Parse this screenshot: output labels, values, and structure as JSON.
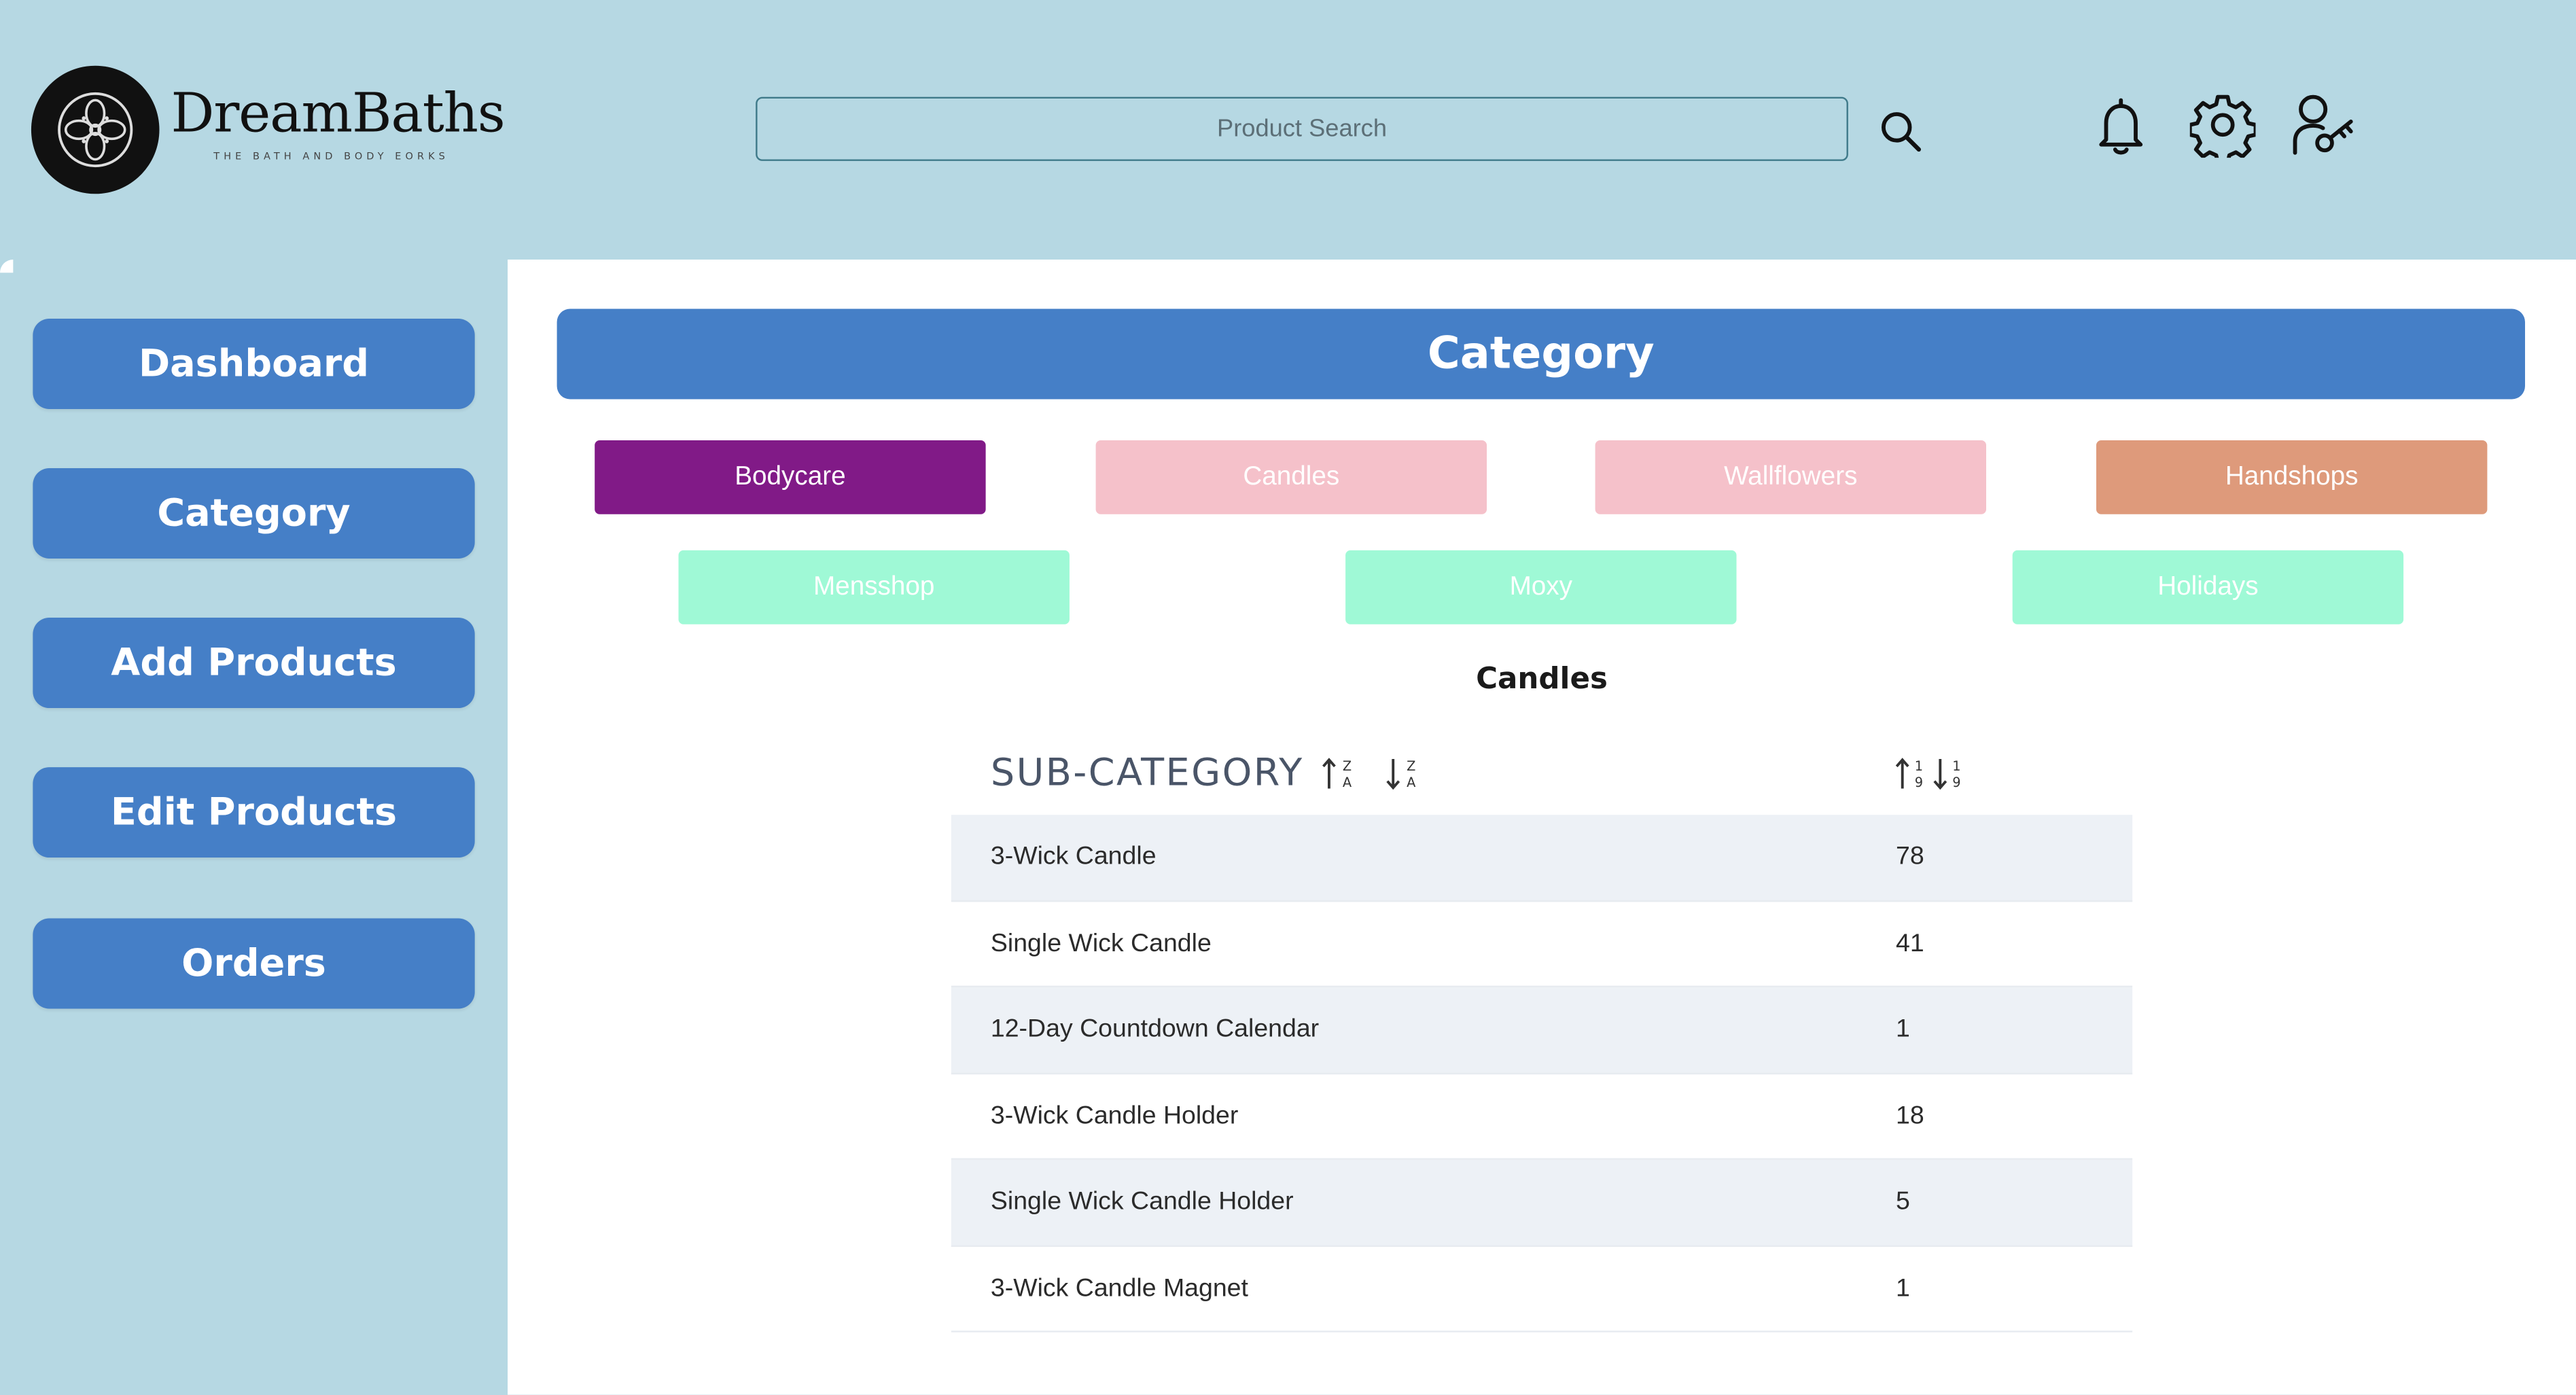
{
  "brand": {
    "name": "DreamBaths",
    "tagline": "THE BATH AND BODY EORKS"
  },
  "header": {
    "search_placeholder": "Product Search",
    "icons": [
      "search-icon",
      "bell-icon",
      "gear-icon",
      "user-key-icon"
    ]
  },
  "sidebar": {
    "items": [
      {
        "label": "Dashboard"
      },
      {
        "label": "Category"
      },
      {
        "label": "Add Products"
      },
      {
        "label": "Edit Products"
      },
      {
        "label": "Orders"
      }
    ]
  },
  "main": {
    "title": "Category",
    "categories": [
      {
        "label": "Bodycare",
        "color": "#811a87",
        "text_color": "#ffffff"
      },
      {
        "label": "Candles",
        "color": "#f5c1ca",
        "text_color": "#ffffff"
      },
      {
        "label": "Wallflowers",
        "color": "#f5c1ca",
        "text_color": "#ffffff"
      },
      {
        "label": "Handshops",
        "color": "#de9a7b",
        "text_color": "#ffffff"
      },
      {
        "label": "Mensshop",
        "color": "#9ff9d6",
        "text_color": "#ffffff"
      },
      {
        "label": "Moxy",
        "color": "#9ff9d6",
        "text_color": "#ffffff"
      },
      {
        "label": "Holidays",
        "color": "#9ff9d6",
        "text_color": "#ffffff"
      }
    ],
    "selected_category": "Candles",
    "table": {
      "header": "SUB-CATEGORY",
      "rows": [
        {
          "name": "3-Wick Candle",
          "count": "78"
        },
        {
          "name": "Single Wick Candle",
          "count": "41"
        },
        {
          "name": "12-Day Countdown Calendar",
          "count": "1"
        },
        {
          "name": "3-Wick Candle Holder",
          "count": "18"
        },
        {
          "name": "Single Wick Candle Holder",
          "count": "5"
        },
        {
          "name": "3-Wick Candle Magnet",
          "count": "1"
        }
      ]
    }
  },
  "colors": {
    "background": "#b6d8e3",
    "accent": "#457fc7",
    "panel": "#ffffff",
    "row_alt": "#edf1f6"
  }
}
